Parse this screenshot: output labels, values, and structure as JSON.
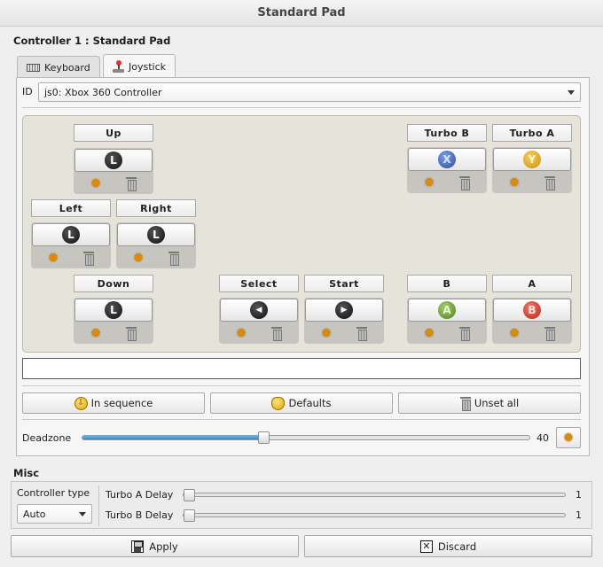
{
  "window": {
    "title": "Standard Pad"
  },
  "controller": {
    "heading": "Controller 1 : Standard Pad",
    "tabs": [
      {
        "label": "Keyboard",
        "icon": "keyboard-icon"
      },
      {
        "label": "Joystick",
        "icon": "joystick-icon",
        "active": true
      }
    ],
    "id_label": "ID",
    "id_value": "js0: Xbox 360 Controller"
  },
  "bindings": {
    "up": {
      "label": "Up",
      "glyph": "L",
      "icon": "left-stick-up-icon"
    },
    "left": {
      "label": "Left",
      "glyph": "L",
      "icon": "left-stick-left-icon"
    },
    "right": {
      "label": "Right",
      "glyph": "L",
      "icon": "left-stick-right-icon"
    },
    "down": {
      "label": "Down",
      "glyph": "L",
      "icon": "left-stick-down-icon"
    },
    "select": {
      "label": "Select",
      "glyph": "◀",
      "icon": "back-button-icon"
    },
    "start": {
      "label": "Start",
      "glyph": "▶",
      "icon": "start-button-icon"
    },
    "turbo_b": {
      "label": "Turbo B",
      "glyph": "X",
      "icon": "x-button-icon",
      "color": "#3a5eb3"
    },
    "turbo_a": {
      "label": "Turbo A",
      "glyph": "Y",
      "icon": "y-button-icon",
      "color": "#e3a21e"
    },
    "b": {
      "label": "B",
      "glyph": "A",
      "icon": "a-button-icon",
      "color": "#5f9a2c"
    },
    "a": {
      "label": "A",
      "glyph": "B",
      "icon": "b-button-icon",
      "color": "#c93224"
    }
  },
  "status_text": "",
  "actions": {
    "in_sequence": "In sequence",
    "defaults": "Defaults",
    "unset_all": "Unset all"
  },
  "deadzone": {
    "label": "Deadzone",
    "value": "40",
    "fraction": 0.4
  },
  "misc": {
    "heading": "Misc",
    "controller_type_label": "Controller type",
    "controller_type_value": "Auto",
    "turbo_a_label": "Turbo A Delay",
    "turbo_a_value": "1",
    "turbo_b_label": "Turbo B Delay",
    "turbo_b_value": "1"
  },
  "buttons": {
    "apply": "Apply",
    "discard": "Discard"
  }
}
